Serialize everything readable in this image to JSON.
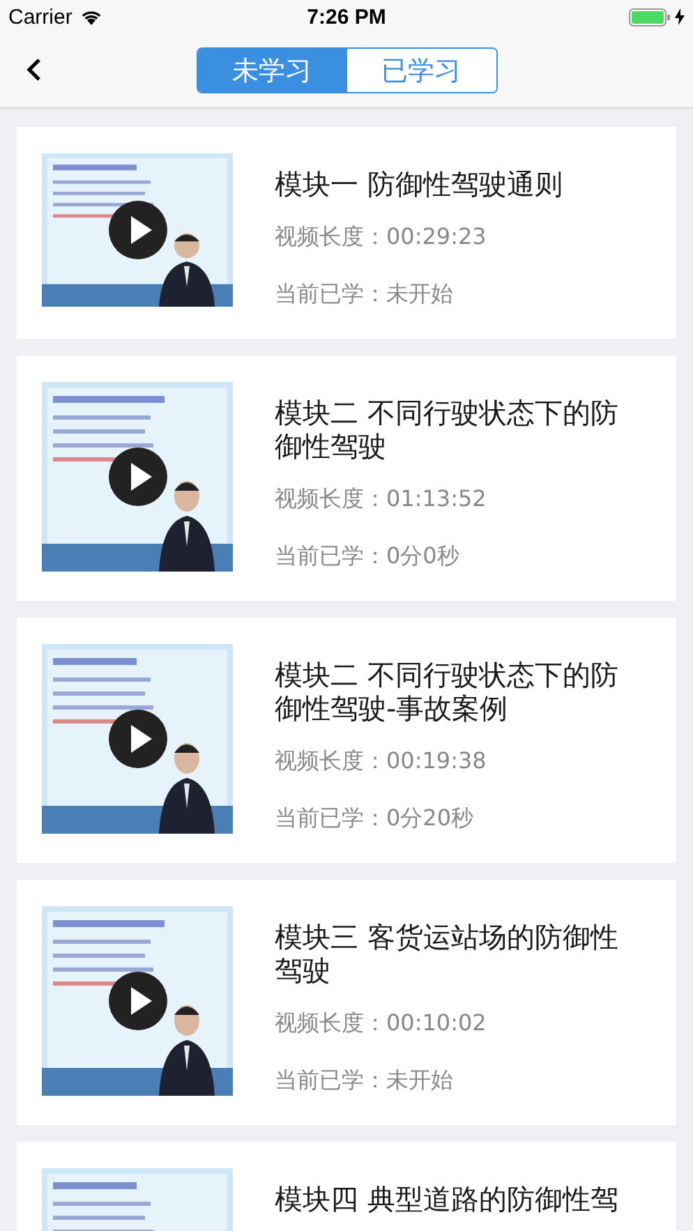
{
  "status_bar": {
    "carrier": "Carrier",
    "time": "7:26 PM"
  },
  "nav": {
    "tabs": [
      {
        "label": "未学习",
        "selected": true
      },
      {
        "label": "已学习",
        "selected": false
      }
    ]
  },
  "lessons": [
    {
      "title": "模块一 防御性驾驶通则",
      "duration": "视频长度：00:29:23",
      "progress": "当前已学：未开始"
    },
    {
      "title": "模块二 不同行驶状态下的防御性驾驶",
      "duration": "视频长度：01:13:52",
      "progress": "当前已学：0分0秒"
    },
    {
      "title": "模块二 不同行驶状态下的防御性驾驶-事故案例",
      "duration": "视频长度：00:19:38",
      "progress": "当前已学：0分20秒"
    },
    {
      "title": "模块三 客货运站场的防御性驾驶",
      "duration": "视频长度：00:10:02",
      "progress": "当前已学：未开始"
    },
    {
      "title": "模块四 典型道路的防御性驾"
    }
  ]
}
